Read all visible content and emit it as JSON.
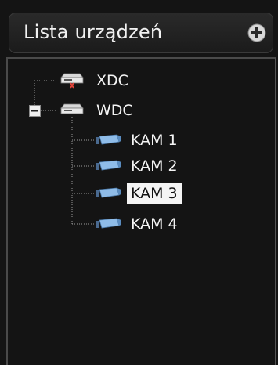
{
  "header": {
    "title": "Lista urządzeń",
    "add_icon": "plus-circle-icon"
  },
  "tree": {
    "nodes": [
      {
        "label": "XDC",
        "icon": "recorder-disconnected-icon"
      },
      {
        "label": "WDC",
        "icon": "recorder-icon",
        "expanded": true
      },
      {
        "label": "KAM 1",
        "icon": "camera-icon"
      },
      {
        "label": "KAM 2",
        "icon": "camera-icon"
      },
      {
        "label": "KAM 3",
        "icon": "camera-icon",
        "selected": true
      },
      {
        "label": "KAM 4",
        "icon": "camera-icon"
      }
    ],
    "collapse_icon": "minus-box-icon"
  },
  "colors": {
    "background": "#141414",
    "text": "#f4f4f4",
    "selection": "#f4f4f4",
    "camera": "#7ab0e8"
  }
}
